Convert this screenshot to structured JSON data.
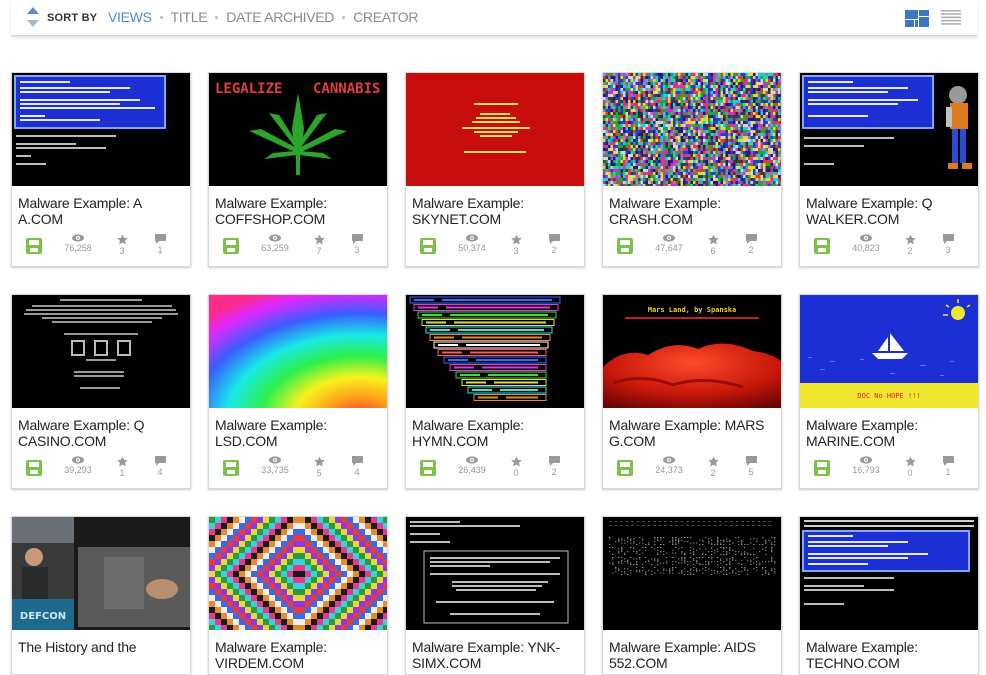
{
  "sortbar": {
    "label": "SORT BY",
    "options": [
      {
        "label": "VIEWS",
        "active": true
      },
      {
        "label": "TITLE",
        "active": false
      },
      {
        "label": "DATE ARCHIVED",
        "active": false
      },
      {
        "label": "CREATOR",
        "active": false
      }
    ]
  },
  "colors": {
    "accent": "#4a8ec8",
    "save_icon": "#7cc24a",
    "stat_icon": "#9a9a9a"
  },
  "items": [
    {
      "title": "Malware Example: A A.COM",
      "views": "76,258",
      "favs": "3",
      "reviews": "1",
      "thumb": "dos-blue"
    },
    {
      "title": "Malware Example: COFFSHOP.COM",
      "views": "63,259",
      "favs": "7",
      "reviews": "3",
      "thumb": "leaf",
      "thumb_text_left": "LEGALIZE",
      "thumb_text_right": "CANNABIS"
    },
    {
      "title": "Malware Example: SKYNET.COM",
      "views": "50,374",
      "favs": "3",
      "reviews": "2",
      "thumb": "red"
    },
    {
      "title": "Malware Example: CRASH.COM",
      "views": "47,647",
      "favs": "6",
      "reviews": "2",
      "thumb": "noise"
    },
    {
      "title": "Malware Example: Q WALKER.COM",
      "views": "40,823",
      "favs": "2",
      "reviews": "3",
      "thumb": "walker"
    },
    {
      "title": "Malware Example: Q CASINO.COM",
      "views": "39,293",
      "favs": "1",
      "reviews": "4",
      "thumb": "casino"
    },
    {
      "title": "Malware Example: LSD.COM",
      "views": "33,735",
      "favs": "5",
      "reviews": "4",
      "thumb": "rainbow"
    },
    {
      "title": "Malware Example: HYMN.COM",
      "views": "26,439",
      "favs": "0",
      "reviews": "2",
      "thumb": "hymn"
    },
    {
      "title": "Malware Example: MARS G.COM",
      "views": "24,373",
      "favs": "2",
      "reviews": "5",
      "thumb": "mars",
      "thumb_text": "Mars Land, by Spanska"
    },
    {
      "title": "Malware Example: MARINE.COM",
      "views": "16,793",
      "favs": "0",
      "reviews": "1",
      "thumb": "marine"
    },
    {
      "title": "The History and the",
      "thumb": "defcon",
      "thumb_text": "DEFCON"
    },
    {
      "title": "Malware Example: VIRDEM.COM",
      "thumb": "diamond"
    },
    {
      "title": "Malware Example: YNK-SIMX.COM",
      "thumb": "dos-box"
    },
    {
      "title": "Malware Example: AIDS 552.COM",
      "thumb": "aids"
    },
    {
      "title": "Malware Example: TECHNO.COM",
      "thumb": "techno"
    }
  ]
}
